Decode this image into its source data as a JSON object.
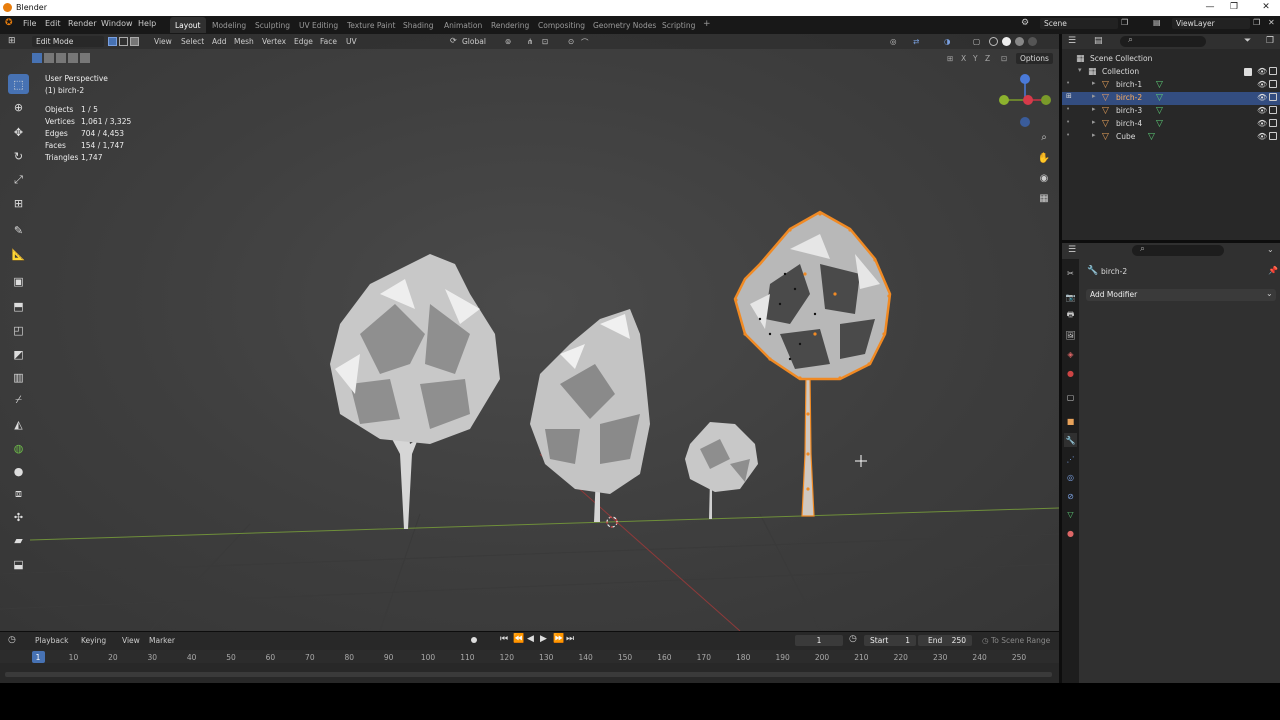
{
  "window": {
    "title": "Blender",
    "controls": [
      "—",
      "❐",
      "✕"
    ]
  },
  "menus": [
    "File",
    "Edit",
    "Render",
    "Window",
    "Help"
  ],
  "workspaces": [
    {
      "label": "Layout",
      "active": true
    },
    {
      "label": "Modeling"
    },
    {
      "label": "Sculpting"
    },
    {
      "label": "UV Editing"
    },
    {
      "label": "Texture Paint"
    },
    {
      "label": "Shading"
    },
    {
      "label": "Animation"
    },
    {
      "label": "Rendering"
    },
    {
      "label": "Compositing"
    },
    {
      "label": "Geometry Nodes"
    },
    {
      "label": "Scripting"
    }
  ],
  "add_workspace": "+",
  "scene": {
    "label": "Scene",
    "view_layer": "ViewLayer"
  },
  "viewport_header": {
    "mode": "Edit Mode",
    "menus": [
      "View",
      "Select",
      "Add",
      "Mesh",
      "Vertex",
      "Edge",
      "Face",
      "UV"
    ],
    "orientation": "Global",
    "options": "Options",
    "axes": [
      "X",
      "Y",
      "Z"
    ]
  },
  "overlay_text": {
    "perspective": "User Perspective",
    "object": "(1) birch-2",
    "stats": [
      {
        "label": "Objects",
        "value": "1 / 5"
      },
      {
        "label": "Vertices",
        "value": "1,061 / 3,325"
      },
      {
        "label": "Edges",
        "value": "704 / 4,453"
      },
      {
        "label": "Faces",
        "value": "154 / 1,747"
      },
      {
        "label": "Triangles",
        "value": "1,747"
      }
    ]
  },
  "tools": [
    "select-box",
    "cursor",
    "move",
    "rotate",
    "scale",
    "transform",
    "annotate",
    "measure",
    "add-cube",
    "extrude",
    "inset",
    "bevel",
    "loop-cut",
    "knife",
    "poly-build",
    "spin",
    "smooth",
    "edge-slide",
    "shrink-fatten",
    "shear",
    "rip-region"
  ],
  "outliner": {
    "root": "Scene Collection",
    "collection": "Collection",
    "items": [
      {
        "label": "birch-1",
        "selected": false
      },
      {
        "label": "birch-2",
        "selected": true
      },
      {
        "label": "birch-3",
        "selected": false
      },
      {
        "label": "birch-4",
        "selected": false
      },
      {
        "label": "Cube",
        "selected": false
      }
    ]
  },
  "properties": {
    "object_name": "birch-2",
    "add_modifier": "Add Modifier"
  },
  "timeline": {
    "menus": [
      "Playback",
      "Keying",
      "View",
      "Marker"
    ],
    "current_frame": "1",
    "start_label": "Start",
    "start": "1",
    "end_label": "End",
    "end": "250",
    "scene_range": "To Scene Range",
    "ticks": [
      "1",
      "10",
      "20",
      "30",
      "40",
      "50",
      "60",
      "70",
      "80",
      "90",
      "100",
      "110",
      "120",
      "130",
      "140",
      "150",
      "160",
      "170",
      "180",
      "190",
      "200",
      "210",
      "220",
      "230",
      "240",
      "250"
    ]
  },
  "colors": {
    "accent": "#4772b3",
    "selection": "#f08a24",
    "header": "#181818",
    "panel": "#282828"
  }
}
